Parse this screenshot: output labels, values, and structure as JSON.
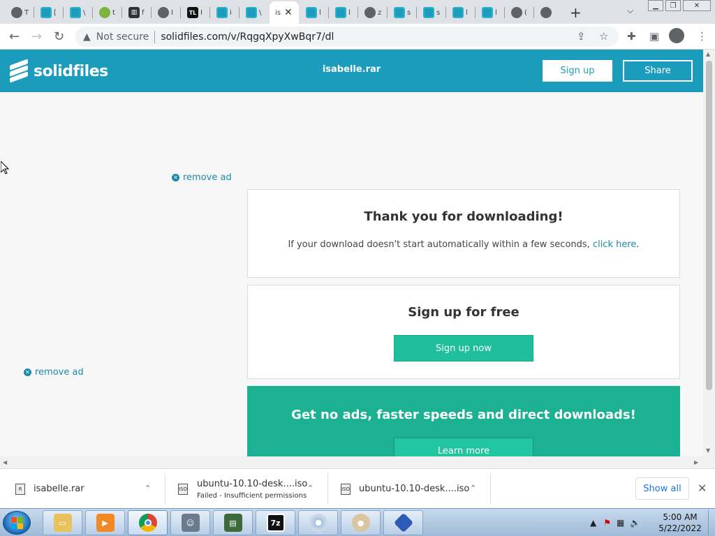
{
  "browser": {
    "tabs": [
      {
        "icon": "globe-icon",
        "title": "T"
      },
      {
        "icon": "solidfiles-icon",
        "title": "["
      },
      {
        "icon": "solidfiles-icon",
        "title": "\\"
      },
      {
        "icon": "cloud-icon",
        "title": "t"
      },
      {
        "icon": "library-icon",
        "title": "f"
      },
      {
        "icon": "globe-icon",
        "title": "I"
      },
      {
        "icon": "tl-icon",
        "title": "I"
      },
      {
        "icon": "solidfiles-icon",
        "title": "i"
      },
      {
        "icon": "solidfiles-icon",
        "title": "\\"
      },
      {
        "icon": "solidfiles-icon",
        "title": "is",
        "active": true
      },
      {
        "icon": "solidfiles-icon",
        "title": "l"
      },
      {
        "icon": "solidfiles-icon",
        "title": "l"
      },
      {
        "icon": "globe-icon",
        "title": "z"
      },
      {
        "icon": "solidfiles-icon",
        "title": "s"
      },
      {
        "icon": "solidfiles-icon",
        "title": "s"
      },
      {
        "icon": "solidfiles-icon",
        "title": "l"
      },
      {
        "icon": "solidfiles-icon",
        "title": "l"
      },
      {
        "icon": "globe-icon",
        "title": "("
      },
      {
        "icon": "chrome-icon",
        "title": ""
      }
    ],
    "tl_label": "TL",
    "security_label": "Not secure",
    "url": "solidfiles.com/v/RqgqXpyXwBqr7/dl"
  },
  "site": {
    "brand": "solidfiles",
    "file_title": "isabelle.rar",
    "signup_label": "Sign up",
    "share_label": "Share",
    "remove_ad_label": "remove ad",
    "thanks_title": "Thank you for downloading!",
    "thanks_text": "If your download doesn't start automatically within a few seconds,",
    "click_here": "click here",
    "period": ".",
    "signup_title": "Sign up for free",
    "signup_now": "Sign up now",
    "promo_title": "Get no ads, faster speeds and direct downloads!",
    "learn_more": "Learn more",
    "colors": {
      "header": "#1b9cbc",
      "accent": "#1fbf9c",
      "promo": "#1bb192"
    }
  },
  "downloads": {
    "items": [
      {
        "name": "isabelle.rar",
        "icon": "rar-file-icon",
        "status": ""
      },
      {
        "name": "ubuntu-10.10-desk....iso",
        "icon": "iso-file-icon",
        "status": "Failed - Insufficient permissions"
      },
      {
        "name": "ubuntu-10.10-desk....iso",
        "icon": "iso-file-icon",
        "status": ""
      }
    ],
    "show_all": "Show all",
    "icon_label": "ISO",
    "rar_label": "R"
  },
  "taskbar": {
    "apps": [
      "file-explorer-icon",
      "media-player-icon",
      "chrome-icon",
      "user-app-icon",
      "monitor-app-icon",
      "7zip-icon",
      "disc-burner-icon",
      "paint-icon",
      "virtualbox-icon"
    ],
    "sevenzip_label": "7z",
    "time": "5:00 AM",
    "date": "5/22/2022"
  }
}
